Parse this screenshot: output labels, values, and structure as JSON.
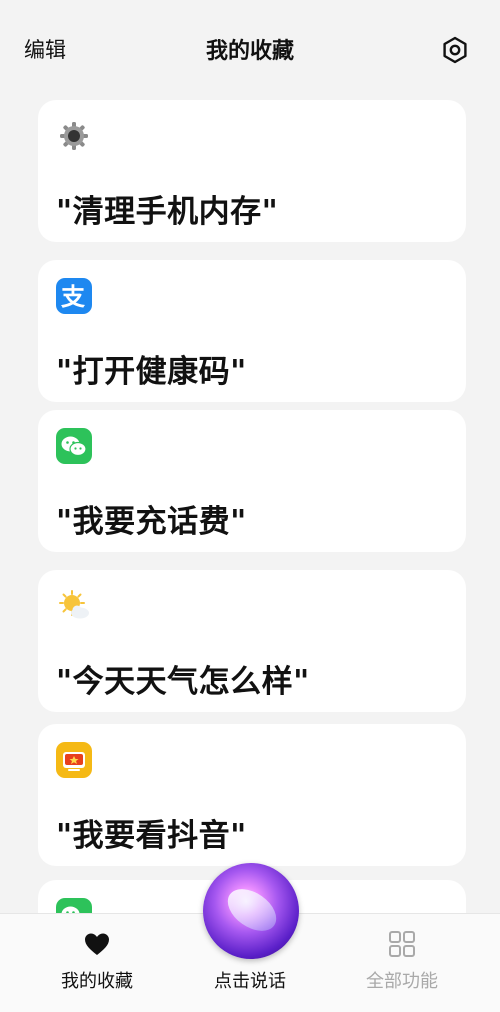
{
  "header": {
    "edit_label": "编辑",
    "title": "我的收藏",
    "settings_icon": "hexagon-settings-icon"
  },
  "cards": [
    {
      "icon": "gear-settings-icon",
      "phrase": "\"清理手机内存\""
    },
    {
      "icon": "alipay-icon",
      "icon_color": "#1e88f0",
      "phrase": "\"打开健康码\""
    },
    {
      "icon": "wechat-icon",
      "icon_color": "#2dc25a",
      "phrase": "\"我要充话费\""
    },
    {
      "icon": "weather-sun-cloud-icon",
      "icon_color": "#f7c43a",
      "phrase": "\"今天天气怎么样\""
    },
    {
      "icon": "video-tv-icon",
      "icon_color": "#f5b915",
      "phrase": "\"我要看抖音\""
    },
    {
      "icon": "wechat-icon",
      "icon_color": "#2dc25a",
      "phrase": ""
    }
  ],
  "bottom_nav": {
    "favorites_label": "我的收藏",
    "voice_label": "点击说话",
    "all_features_label": "全部功能"
  },
  "colors": {
    "background": "#f3f3f3",
    "card": "#ffffff",
    "text": "#111111",
    "inactive_tab": "#a9a9a9"
  }
}
